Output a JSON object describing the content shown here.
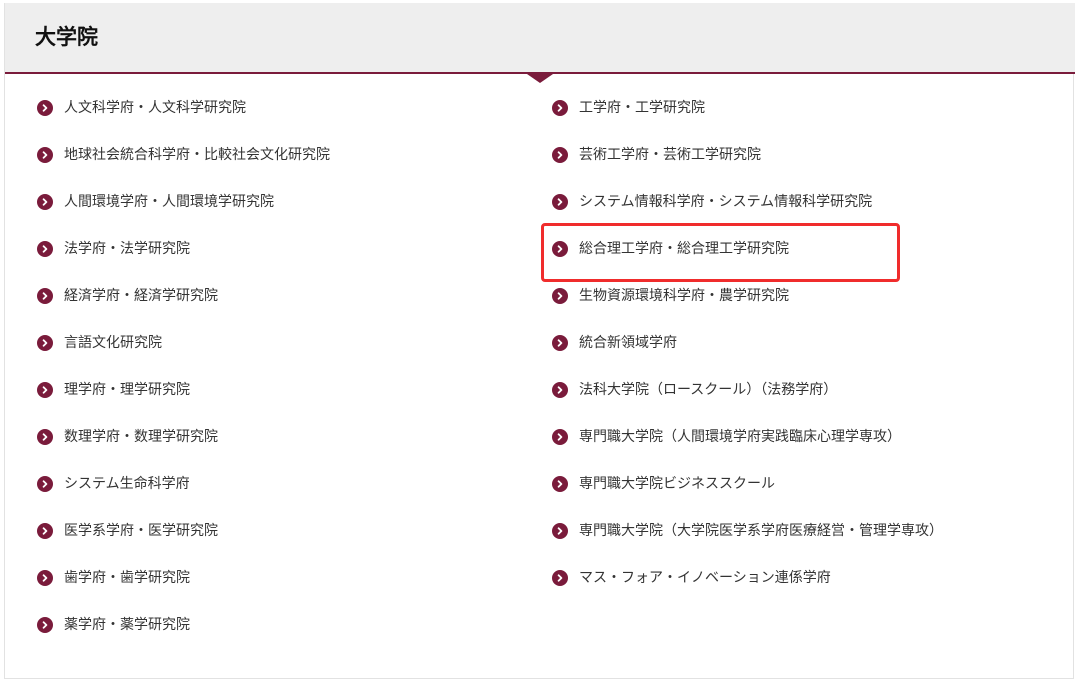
{
  "header": {
    "title": "大学院"
  },
  "colors": {
    "accent": "#7a1b3b",
    "highlight": "#f02c2c",
    "header_bg": "#eeeeee"
  },
  "bullet_icon": "chevron-right-circle-icon",
  "left_column": [
    {
      "label": "人文科学府・人文科学研究院"
    },
    {
      "label": "地球社会統合科学府・比較社会文化研究院"
    },
    {
      "label": "人間環境学府・人間環境学研究院"
    },
    {
      "label": "法学府・法学研究院"
    },
    {
      "label": "経済学府・経済学研究院"
    },
    {
      "label": "言語文化研究院"
    },
    {
      "label": "理学府・理学研究院"
    },
    {
      "label": "数理学府・数理学研究院"
    },
    {
      "label": "システム生命科学府"
    },
    {
      "label": "医学系学府・医学研究院"
    },
    {
      "label": "歯学府・歯学研究院"
    },
    {
      "label": "薬学府・薬学研究院"
    }
  ],
  "right_column": [
    {
      "label": "工学府・工学研究院"
    },
    {
      "label": "芸術工学府・芸術工学研究院"
    },
    {
      "label": "システム情報科学府・システム情報科学研究院"
    },
    {
      "label": "総合理工学府・総合理工学研究院",
      "highlighted": true
    },
    {
      "label": "生物資源環境科学府・農学研究院"
    },
    {
      "label": "統合新領域学府"
    },
    {
      "label": "法科大学院（ロースクール）（法務学府）"
    },
    {
      "label": "専門職大学院（人間環境学府実践臨床心理学専攻）"
    },
    {
      "label": "専門職大学院ビジネススクール"
    },
    {
      "label": "専門職大学院（大学院医学系学府医療経営・管理学専攻）"
    },
    {
      "label": "マス・フォア・イノベーション連係学府"
    }
  ]
}
